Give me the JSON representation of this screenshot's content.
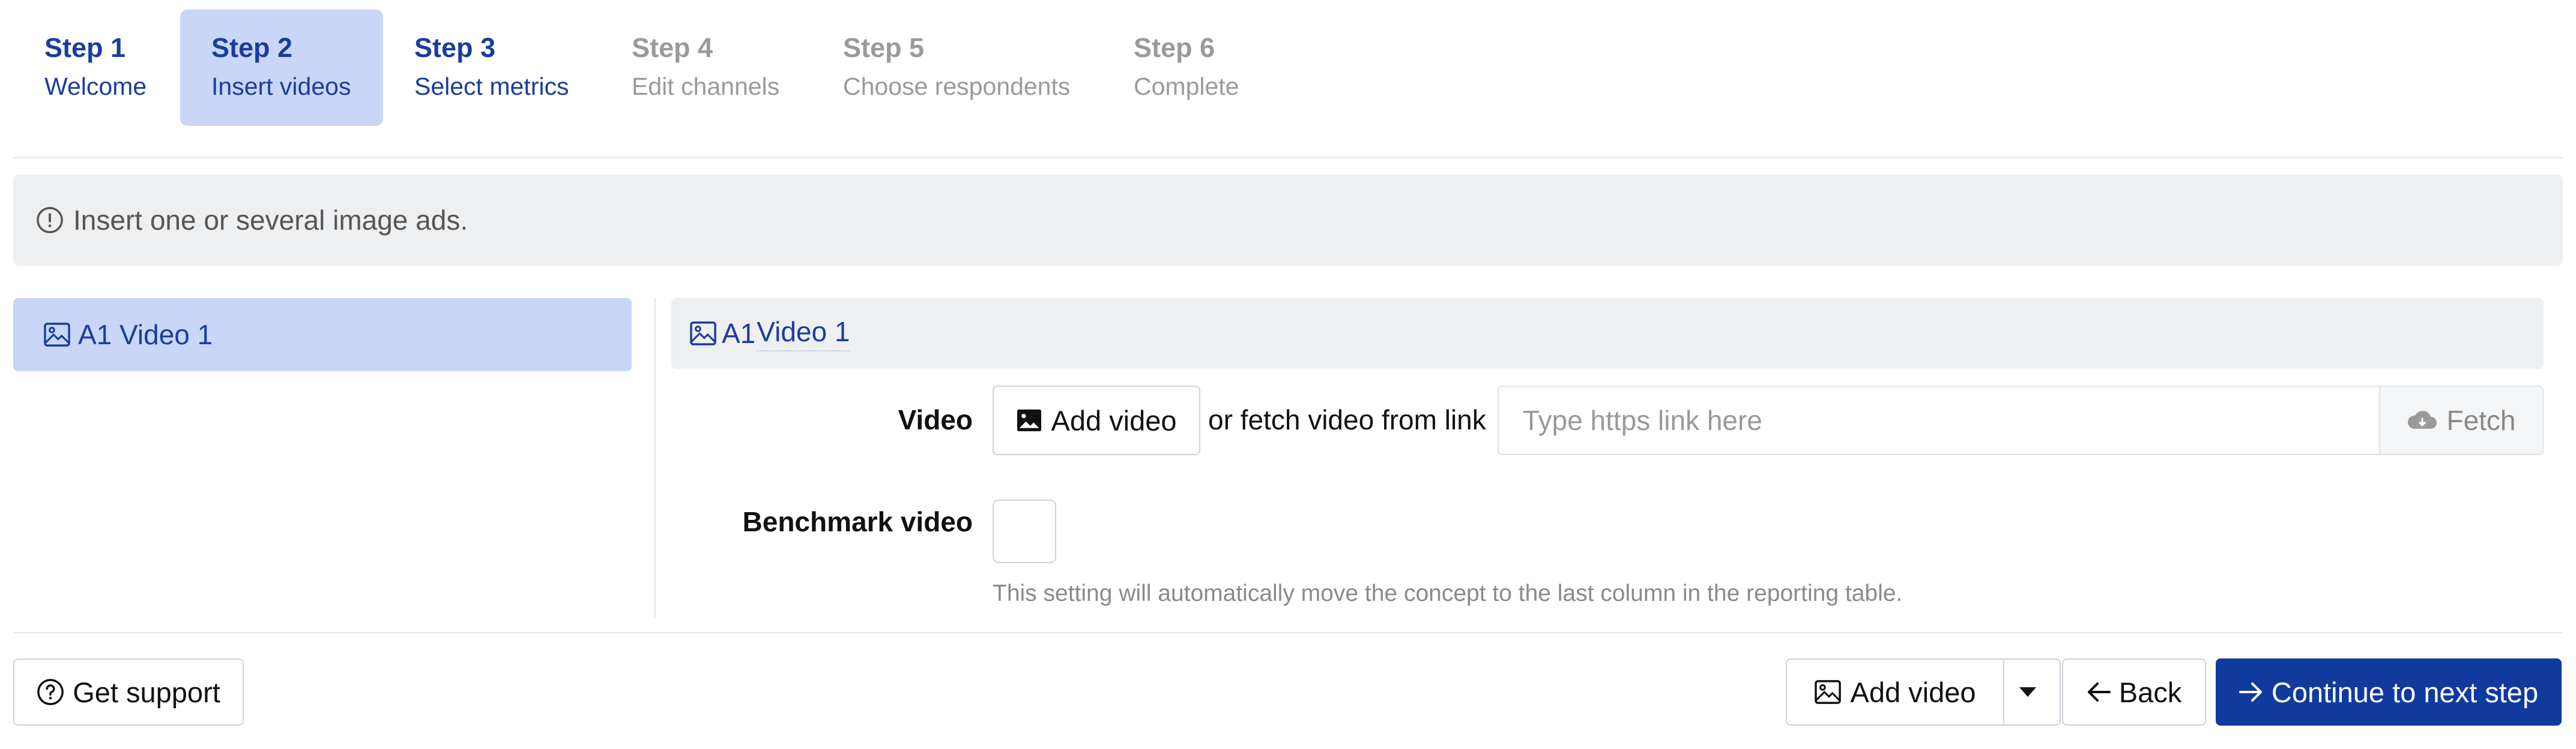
{
  "steps": [
    {
      "num": "Step 1",
      "name": "Welcome",
      "state": "done"
    },
    {
      "num": "Step 2",
      "name": "Insert videos",
      "state": "active"
    },
    {
      "num": "Step 3",
      "name": "Select metrics",
      "state": "done"
    },
    {
      "num": "Step 4",
      "name": "Edit channels",
      "state": "future"
    },
    {
      "num": "Step 5",
      "name": "Choose respondents",
      "state": "future"
    },
    {
      "num": "Step 6",
      "name": "Complete",
      "state": "future"
    }
  ],
  "info": {
    "icon": "exclamation-circle-icon",
    "text": "Insert one or several image ads."
  },
  "sidebar": {
    "items": [
      {
        "label": "A1 Video 1",
        "icon": "image-icon"
      }
    ]
  },
  "panel": {
    "prefix": "A1",
    "title": "Video 1",
    "video_label": "Video",
    "add_video_label": "Add video",
    "or_fetch_text": "or fetch video from link",
    "link_placeholder": "Type https link here",
    "fetch_label": "Fetch",
    "benchmark_label": "Benchmark video",
    "benchmark_help": "This setting will automatically move the concept to the last column in the reporting table."
  },
  "footer": {
    "support_label": "Get support",
    "add_video_label": "Add video",
    "back_label": "Back",
    "continue_label": "Continue to next step"
  },
  "colors": {
    "accent": "#1a3d9c",
    "primary_button": "#103a9e",
    "active_bg": "#c9d6f7"
  }
}
